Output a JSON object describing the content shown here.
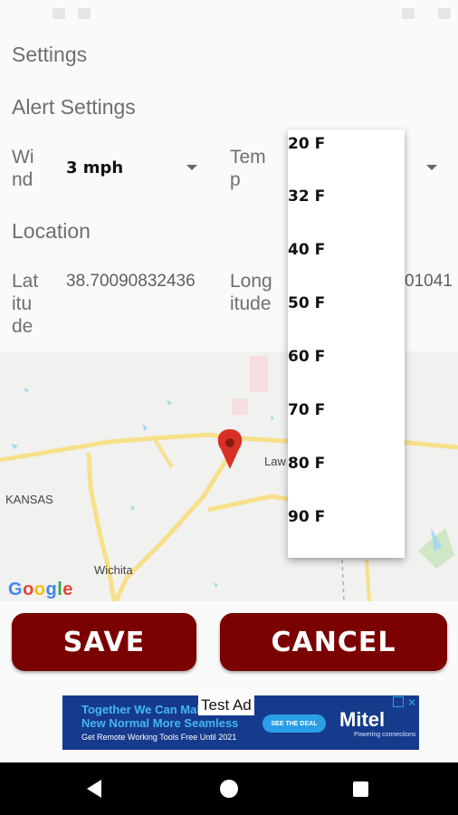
{
  "title": "Settings",
  "alert_section": "Alert Settings",
  "wind": {
    "label": "Wind",
    "line1": "Wi",
    "line2": "nd",
    "value": "3 mph"
  },
  "temp": {
    "label": "Temp",
    "line1": "Tem",
    "line2": "p"
  },
  "location_section": "Location",
  "latitude": {
    "line1": "Lat",
    "line2": "itu",
    "line3": "de",
    "value": "38.70090832436"
  },
  "longitude": {
    "line1": "Long",
    "line2": "itude",
    "value_tail": "01041"
  },
  "map": {
    "labels": {
      "kansas": "KANSAS",
      "wichita": "Wichita",
      "lawrence": "Law"
    },
    "logo": "Google",
    "logo_colors": [
      "#4285F4",
      "#EA4335",
      "#FBBC05",
      "#4285F4",
      "#34A853",
      "#EA4335"
    ]
  },
  "temp_dropdown": {
    "options": [
      "20 F",
      "32 F",
      "40 F",
      "50 F",
      "60 F",
      "70 F",
      "80 F",
      "90 F"
    ]
  },
  "buttons": {
    "save": "SAVE",
    "cancel": "CANCEL"
  },
  "ad": {
    "test_label": "Test Ad",
    "line1": "Together We Can Make",
    "line2": "New Normal More Seamless",
    "line3": "Get Remote Working Tools Free Until 2021",
    "cta": "SEE THE DEAL",
    "brand": "Mitel",
    "tagline": "Powering connections"
  },
  "colors": {
    "button_bg": "#7b0000",
    "ad_bg": "#173b8c",
    "marker": "#d93025"
  }
}
